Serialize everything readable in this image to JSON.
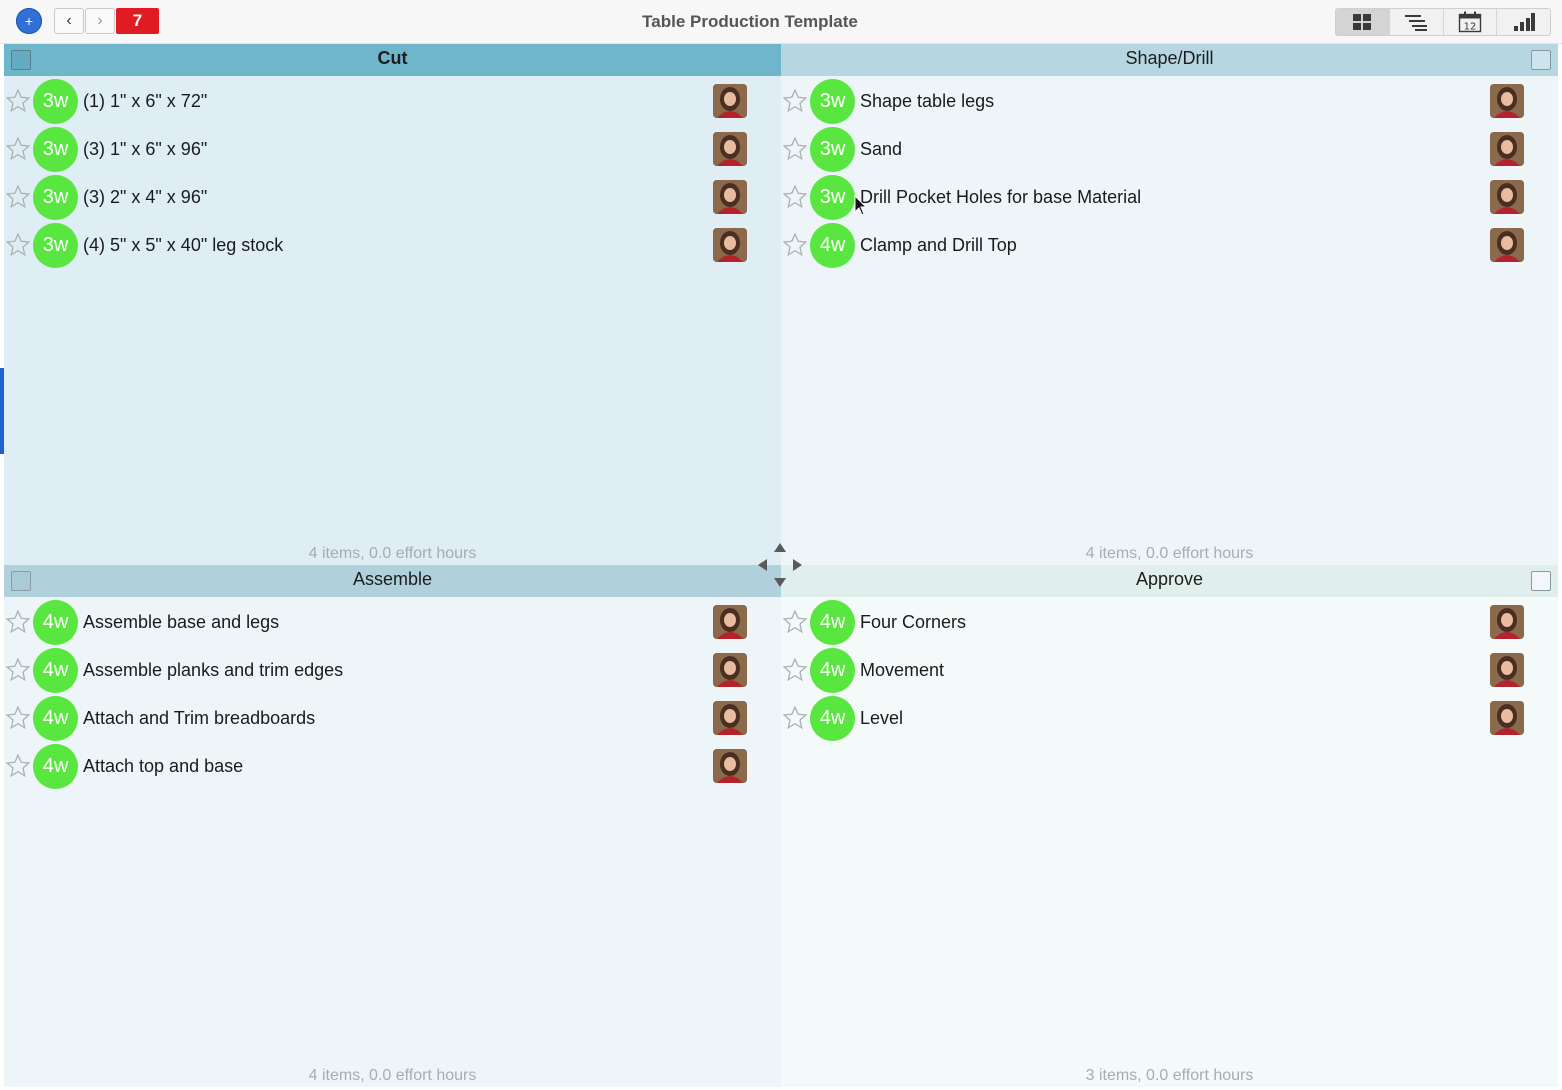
{
  "toolbar": {
    "add_symbol": "+",
    "back_symbol": "‹",
    "forward_symbol": "›",
    "badge_count": "7"
  },
  "window": {
    "title": "Table Production Template"
  },
  "view_switch": {
    "options": [
      "grid-view-icon",
      "outline-view-icon",
      "calendar-view-icon",
      "chart-view-icon"
    ],
    "calendar_day": "12",
    "active": "grid-view-icon"
  },
  "quadrants": {
    "cut": {
      "title": "Cut",
      "footer": "4 items, 0.0 effort hours",
      "items": [
        {
          "duration": "3w",
          "text": "(1) 1\" x 6\" x 72\""
        },
        {
          "duration": "3w",
          "text": "(3) 1\" x 6\" x 96\""
        },
        {
          "duration": "3w",
          "text": "(3) 2\" x 4\" x 96\""
        },
        {
          "duration": "3w",
          "text": "(4) 5\" x 5\" x 40\" leg stock"
        }
      ]
    },
    "shape": {
      "title": "Shape/Drill",
      "footer": "4 items, 0.0 effort hours",
      "items": [
        {
          "duration": "3w",
          "text": "Shape table legs"
        },
        {
          "duration": "3w",
          "text": "Sand"
        },
        {
          "duration": "3w",
          "text": "Drill Pocket Holes for base Material"
        },
        {
          "duration": "4w",
          "text": "Clamp and Drill Top"
        }
      ]
    },
    "assemble": {
      "title": "Assemble",
      "footer": "4 items, 0.0 effort hours",
      "items": [
        {
          "duration": "4w",
          "text": "Assemble base and legs"
        },
        {
          "duration": "4w",
          "text": "Assemble planks and trim edges"
        },
        {
          "duration": "4w",
          "text": "Attach and Trim breadboards"
        },
        {
          "duration": "4w",
          "text": "Attach top and base"
        }
      ]
    },
    "approve": {
      "title": "Approve",
      "footer": "3 items, 0.0 effort hours",
      "items": [
        {
          "duration": "4w",
          "text": "Four Corners"
        },
        {
          "duration": "4w",
          "text": "Movement"
        },
        {
          "duration": "4w",
          "text": "Level"
        }
      ]
    }
  },
  "colors": {
    "duration_badge": "#5ae640",
    "cut_header": "#6fb6cb",
    "alert_badge": "#e11b22",
    "add_button": "#2f6fd6"
  }
}
